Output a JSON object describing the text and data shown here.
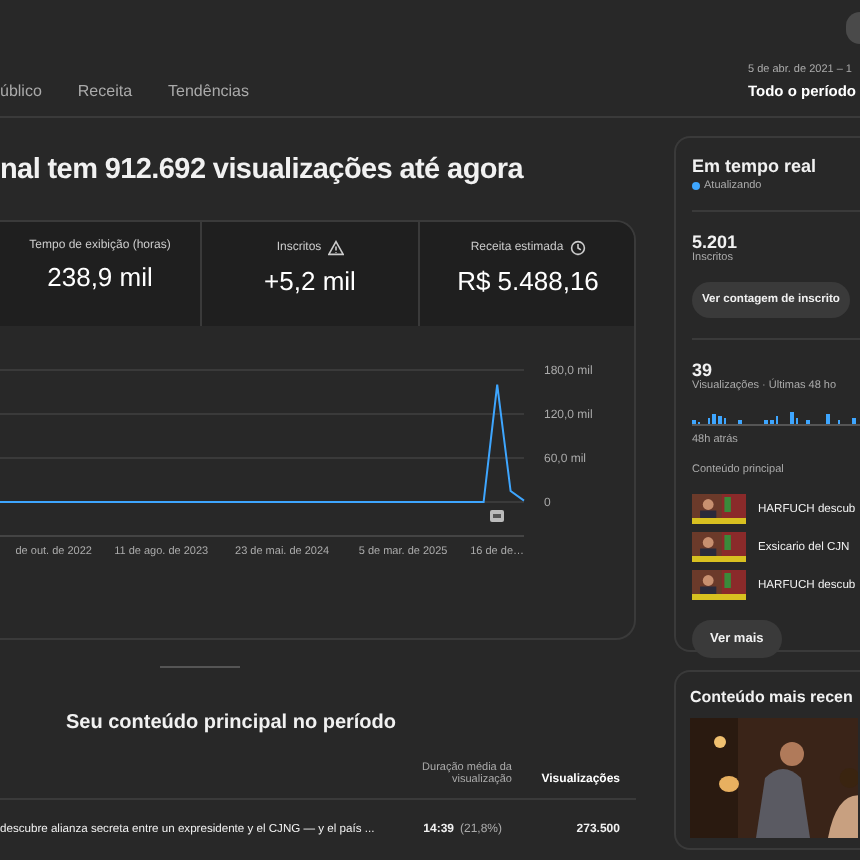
{
  "tabs": [
    {
      "label": "úblico",
      "selected": false
    },
    {
      "label": "Receita",
      "selected": false
    },
    {
      "label": "Tendências",
      "selected": false
    }
  ],
  "period": {
    "range": "5 de abr. de 2021 – 1",
    "label": "Todo o período"
  },
  "headline": "nal tem 912.692 visualizações até agora",
  "metrics": [
    {
      "label": "Tempo de exibição (horas)",
      "value": "238,9 mil"
    },
    {
      "label": "Inscritos",
      "value": "+5,2 mil"
    },
    {
      "label": "Receita estimada",
      "value": "R$ 5.488,16"
    }
  ],
  "chart_data": {
    "type": "line",
    "categories": [
      null,
      null,
      null,
      null,
      "de out. de 2022",
      null,
      null,
      null,
      null,
      null,
      null,
      null,
      "11 de ago. de 2023",
      null,
      null,
      null,
      null,
      null,
      null,
      null,
      null,
      "23 de mai. de 2024",
      null,
      null,
      null,
      null,
      null,
      null,
      null,
      null,
      "5 de mar. de 2025",
      null,
      null,
      null,
      null,
      null,
      null,
      "16 de de…",
      null,
      null
    ],
    "series": [
      {
        "color": "#3ea6ff",
        "values": [
          0,
          0,
          0,
          0,
          0,
          0,
          0,
          0,
          0,
          0,
          0,
          0,
          0,
          0,
          0,
          0,
          0,
          0,
          0,
          0,
          0,
          0,
          0,
          0,
          0,
          0,
          0,
          0,
          0,
          0,
          0,
          0,
          0,
          0,
          0,
          0,
          0,
          160,
          15,
          2
        ]
      }
    ],
    "ylim": [
      0,
      180
    ],
    "yticks": [
      {
        "value": 0,
        "label": "0"
      },
      {
        "value": 60,
        "label": "60,0 mil"
      },
      {
        "value": 120,
        "label": "120,0 mil"
      },
      {
        "value": 180,
        "label": "180,0 mil"
      }
    ]
  },
  "top_content": {
    "title": "Seu conteúdo principal no período",
    "columns": [
      "Duração média da visualização",
      "Visualizações"
    ],
    "rows": [
      {
        "title": "descubre alianza secreta entre un expresidente y el CJNG — y el país ...",
        "duration": "14:39",
        "share": "(21,8%)",
        "views": "273.500"
      }
    ]
  },
  "realtime": {
    "title": "Em tempo real",
    "status": "Atualizando",
    "subscribers": "5.201",
    "subscribers_label": "Inscritos",
    "subscribers_button": "Ver contagem de inscrito",
    "views": "39",
    "views_label": "Visualizações · Últimas 48 ho",
    "since": "48h atrás",
    "content_label": "Conteúdo principal",
    "items": [
      {
        "kind": "picture",
        "title": "HARFUCH descub"
      },
      {
        "kind": "picture",
        "title": "Exsicario del CJN"
      },
      {
        "kind": "picture",
        "title": "HARFUCH descub"
      }
    ],
    "more_button": "Ver mais"
  },
  "latest": {
    "title": "Conteúdo mais recen",
    "kind": "picture"
  }
}
